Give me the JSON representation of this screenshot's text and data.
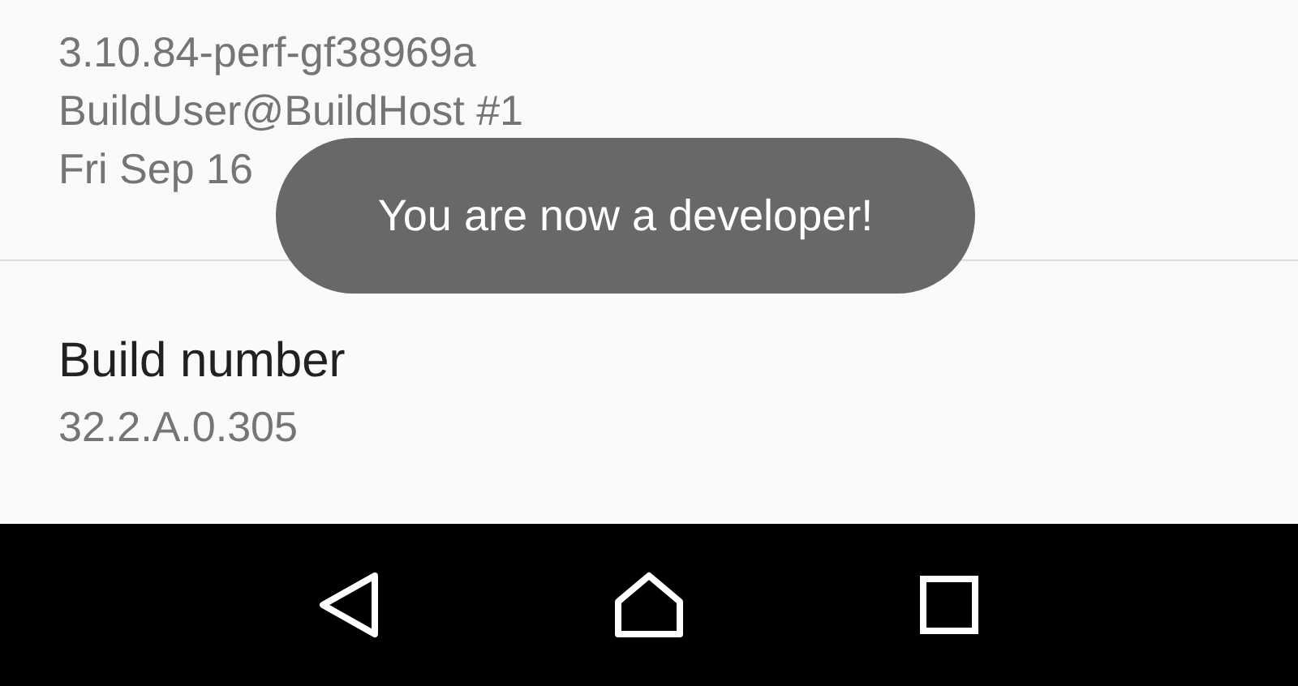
{
  "kernel_version": {
    "lines": [
      "3.10.84-perf-gf38969a",
      "BuildUser@BuildHost #1",
      "Fri Sep 16"
    ]
  },
  "build_number": {
    "title": "Build number",
    "value": "32.2.A.0.305"
  },
  "toast": {
    "text": "You are now a developer!"
  }
}
